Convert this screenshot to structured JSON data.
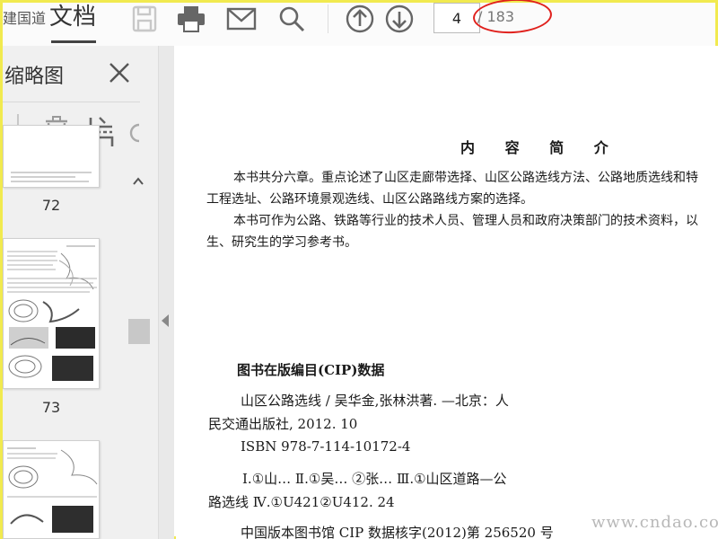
{
  "toolbar": {
    "prev_tab_label": "建国道",
    "tab_title": "文档",
    "page_current": "4",
    "page_total": "/ 183"
  },
  "sidebar": {
    "title": "缩略图",
    "thumbnails": [
      {
        "page": "72"
      },
      {
        "page": "73"
      }
    ]
  },
  "document": {
    "heading": "内 容 简 介",
    "intro_lines": [
      "本书共分六章。重点论述了山区走廊带选择、山区公路选线方法、公路地质选线和特",
      "工程选址、公路环境景观选线、山区公路路线方案的选择。",
      "本书可作为公路、铁路等行业的技术人员、管理人员和政府决策部门的技术资料，以",
      "生、研究生的学习参考书。"
    ],
    "cip_title": "图书在版编目(CIP)数据",
    "cip_lines": [
      "山区公路选线 / 吴华金,张林洪著. —北京：人",
      "民交通出版社, 2012. 10",
      "ISBN 978-7-114-10172-4",
      "Ⅰ.①山…   Ⅱ.①吴…   ②张…   Ⅲ.①山区道路—公",
      "路选线   Ⅳ.①U421②U412. 24",
      "中国版本图书馆 CIP 数据核字(2012)第 256520 号"
    ]
  },
  "watermark": "www.cndao.com",
  "colors": {
    "annotation": "#e0201c",
    "frame": "#f1ea4f"
  }
}
